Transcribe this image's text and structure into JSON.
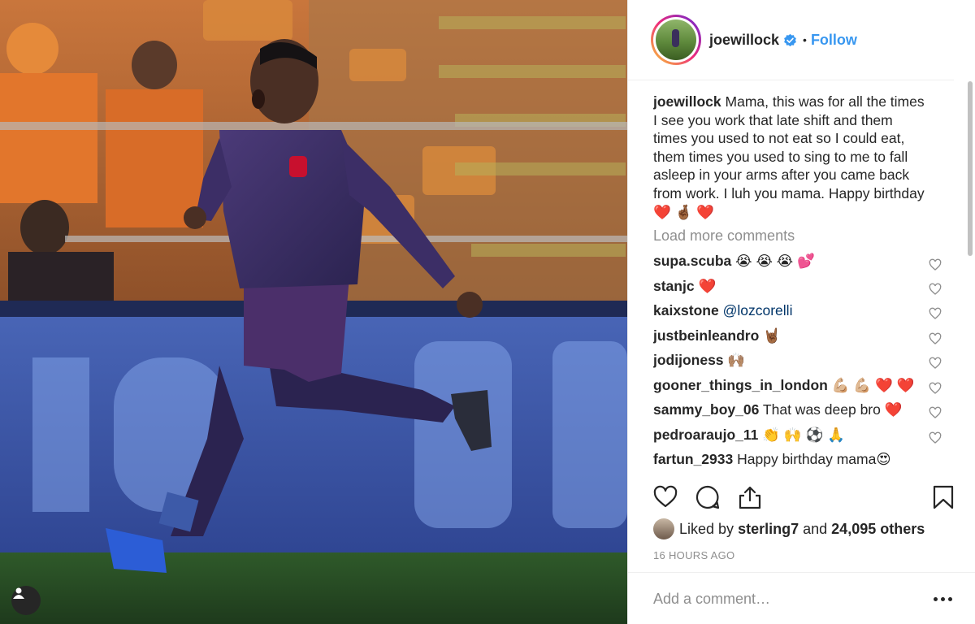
{
  "post": {
    "username": "joewillock",
    "follow_label": "Follow",
    "dot": "•",
    "caption_user": "joewillock",
    "caption_text": "Mama, this was for all the times I see you work that late shift and them times you used to not eat so I could eat, them times you used to sing to me to fall asleep in your arms after you came back from work. I luh you mama. Happy birthday ❤️ 🤞🏾 ❤️",
    "load_more": "Load more comments",
    "comments": [
      {
        "user": "supa.scuba",
        "text": "😭 😭 😭 💕"
      },
      {
        "user": "stanjc",
        "text": "❤️"
      },
      {
        "user": "kaixstone",
        "mention": "@lozcorelli"
      },
      {
        "user": "justbeinleandro",
        "text": "🤘🏾"
      },
      {
        "user": "jodijoness",
        "text": "🙌🏽"
      },
      {
        "user": "gooner_things_in_london",
        "text": "💪🏼 💪🏼 ❤️ ❤️"
      },
      {
        "user": "sammy_boy_06",
        "text": "That was deep bro ❤️"
      },
      {
        "user": "pedroaraujo_11",
        "text": "👏 🙌 ⚽ 🙏"
      },
      {
        "user": "fartun_2933",
        "text": "Happy birthday mama😍"
      }
    ],
    "likes_prefix": "Liked by ",
    "liked_by_user": "sterling7",
    "likes_and": " and ",
    "likes_count": "24,095 others",
    "timestamp": "16 HOURS AGO",
    "comment_placeholder": "Add a comment…"
  },
  "icons": {
    "verified": "verified-badge-icon",
    "like": "heart-icon",
    "comment": "comment-bubble-icon",
    "share": "share-icon",
    "save": "bookmark-icon",
    "more": "more-options-icon",
    "tag": "user-tag-icon"
  },
  "colors": {
    "link_blue": "#3897f0",
    "secondary_text": "#8e8e8e",
    "primary_text": "#262626",
    "mention": "#003569"
  }
}
